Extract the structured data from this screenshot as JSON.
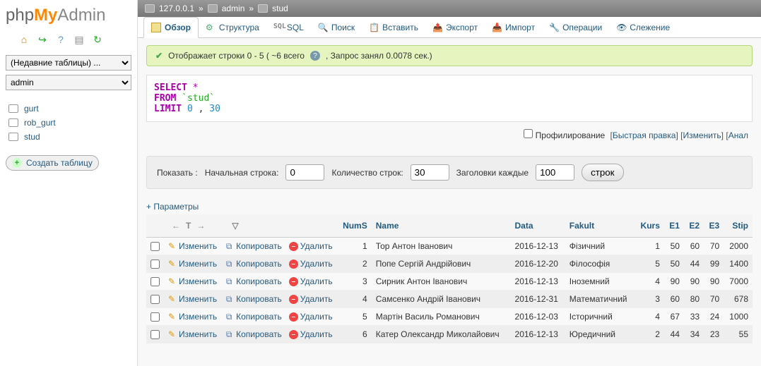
{
  "logo": {
    "p1": "php",
    "p2": "My",
    "p3": "Admin"
  },
  "sidebar": {
    "recent_label": "(Недавние таблицы) ...",
    "db_label": "admin",
    "tables": [
      "gurt",
      "rob_gurt",
      "stud"
    ],
    "create_label": "Создать таблицу"
  },
  "breadcrumb": {
    "host": "127.0.0.1",
    "db": "admin",
    "table": "stud",
    "sep": "»"
  },
  "tabs": {
    "browse": "Обзор",
    "structure": "Структура",
    "sql": "SQL",
    "search": "Поиск",
    "insert": "Вставить",
    "export": "Экспорт",
    "import": "Импорт",
    "operations": "Операции",
    "tracking": "Слежение"
  },
  "success_msg": {
    "pre": "Отображает строки 0 - 5 ( ~6 всего",
    "post": ", Запрос занял 0.0078 сек.)"
  },
  "sql": {
    "select": "SELECT",
    "star": "*",
    "from": "FROM",
    "table": "`stud`",
    "limit": "LIMIT",
    "n0": "0",
    "comma": ",",
    "n1": "30"
  },
  "sql_actions": {
    "profiling": "Профилирование",
    "quick_edit": "Быстрая правка",
    "edit": "Изменить",
    "analyze": "Анал"
  },
  "show_bar": {
    "show": "Показать :",
    "start": "Начальная строка:",
    "start_val": "0",
    "count": "Количество строк:",
    "count_val": "30",
    "headers": "Заголовки каждые",
    "headers_val": "100",
    "rows": "строк"
  },
  "options_label": "+ Параметры",
  "columns": [
    "NumS",
    "Name",
    "Data",
    "Fakult",
    "Kurs",
    "E1",
    "E2",
    "E3",
    "Stip"
  ],
  "actions": {
    "edit": "Изменить",
    "copy": "Копировать",
    "delete": "Удалить"
  },
  "rows": [
    {
      "num": "1",
      "name": "Тор Антон Іванович",
      "data": "2016-12-13",
      "fak": "Фізичний",
      "kurs": "1",
      "e1": "50",
      "e2": "60",
      "e3": "70",
      "stip": "2000"
    },
    {
      "num": "2",
      "name": "Попе Сергій Андрійович",
      "data": "2016-12-20",
      "fak": "Філософія",
      "kurs": "5",
      "e1": "50",
      "e2": "44",
      "e3": "99",
      "stip": "1400"
    },
    {
      "num": "3",
      "name": "Сирник Антон Іванович",
      "data": "2016-12-13",
      "fak": "Іноземний",
      "kurs": "4",
      "e1": "90",
      "e2": "90",
      "e3": "90",
      "stip": "7000"
    },
    {
      "num": "4",
      "name": "Самсенко Андрій Іванович",
      "data": "2016-12-31",
      "fak": "Математичний",
      "kurs": "3",
      "e1": "60",
      "e2": "80",
      "e3": "70",
      "stip": "678"
    },
    {
      "num": "5",
      "name": "Мартін Василь Романович",
      "data": "2016-12-03",
      "fak": "Історичний",
      "kurs": "4",
      "e1": "67",
      "e2": "33",
      "e3": "24",
      "stip": "1000"
    },
    {
      "num": "6",
      "name": "Катер Олександр Миколайович",
      "data": "2016-12-13",
      "fak": "Юредичний",
      "kurs": "2",
      "e1": "44",
      "e2": "34",
      "e3": "23",
      "stip": "55"
    }
  ]
}
